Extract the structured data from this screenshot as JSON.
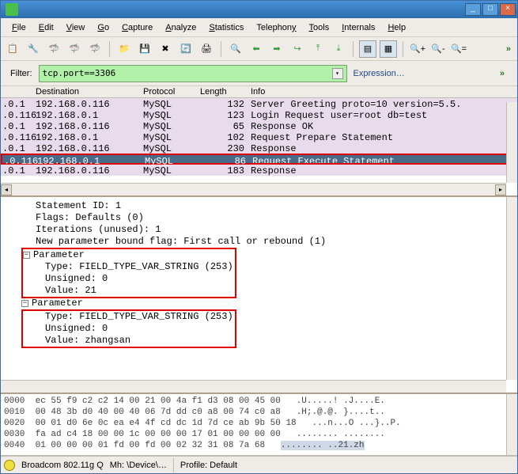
{
  "menu": {
    "file": "File",
    "edit": "Edit",
    "view": "View",
    "go": "Go",
    "capture": "Capture",
    "analyze": "Analyze",
    "statistics": "Statistics",
    "telephony": "Telephony",
    "tools": "Tools",
    "internals": "Internals",
    "help": "Help"
  },
  "filter": {
    "label": "Filter:",
    "value": "tcp.port==3306",
    "expression": "Expression…"
  },
  "columns": {
    "dest": "Destination",
    "proto": "Protocol",
    "length": "Length",
    "info": "Info"
  },
  "packets": [
    {
      "src": ".0.1",
      "dest": "192.168.0.116",
      "proto": "MySQL",
      "len": "132",
      "info": "Server Greeting proto=10 version=5.5.",
      "sel": false
    },
    {
      "src": ".0.116",
      "dest": "192.168.0.1",
      "proto": "MySQL",
      "len": "123",
      "info": "Login Request user=root db=test",
      "sel": false
    },
    {
      "src": ".0.1",
      "dest": "192.168.0.116",
      "proto": "MySQL",
      "len": "65",
      "info": "Response OK",
      "sel": false
    },
    {
      "src": ".0.116",
      "dest": "192.168.0.1",
      "proto": "MySQL",
      "len": "102",
      "info": "Request Prepare Statement",
      "sel": false
    },
    {
      "src": ".0.1",
      "dest": "192.168.0.116",
      "proto": "MySQL",
      "len": "230",
      "info": "Response",
      "sel": false
    },
    {
      "src": ".0.116",
      "dest": "192.168.0.1",
      "proto": "MySQL",
      "len": "86",
      "info": "Request Execute Statement",
      "sel": true,
      "hl": true
    },
    {
      "src": ".0.1",
      "dest": "192.168.0.116",
      "proto": "MySQL",
      "len": "183",
      "info": "Response",
      "sel": false
    }
  ],
  "details": {
    "stmt_id": "Statement ID: 1",
    "flags": "Flags: Defaults (0)",
    "iterations": "Iterations (unused): 1",
    "newparam": "New parameter bound flag: First call or rebound (1)",
    "param_label": "Parameter",
    "p1": {
      "type": "Type: FIELD_TYPE_VAR_STRING (253)",
      "unsigned": "Unsigned: 0",
      "value": "Value: 21"
    },
    "p2": {
      "type": "Type: FIELD_TYPE_VAR_STRING (253)",
      "unsigned": "Unsigned: 0",
      "value": "Value: zhangsan"
    }
  },
  "hex": [
    {
      "ofs": "0000",
      "b": "ec 55 f9 c2 c2 14 00 21  00 4a f1 d3 08 00 45 00",
      "a": ".U.....! .J....E."
    },
    {
      "ofs": "0010",
      "b": "00 48 3b d0 40 00 40 06  7d dd c0 a8 00 74 c0 a8",
      "a": ".H;.@.@. }....t.."
    },
    {
      "ofs": "0020",
      "b": "00 01 d0 6e 0c ea e4 4f cd  dc 1d 7d ce ab 9b 50 18",
      "a": "...n...O ...}..P."
    },
    {
      "ofs": "0030",
      "b": "fa ad c4 18 00 00 1c 00  00 00 17 01 00 00 00 00",
      "a": "........ ........"
    },
    {
      "ofs": "0040",
      "b": "01 00 00 00 01 fd 00 fd  00 02 32 31 08 7a 68",
      "a": "........ ..21.zh"
    }
  ],
  "status": {
    "adapter": "Broadcom 802.11g Q",
    "mh": "Mh: \\Device\\…",
    "profile": "Profile: Default"
  }
}
